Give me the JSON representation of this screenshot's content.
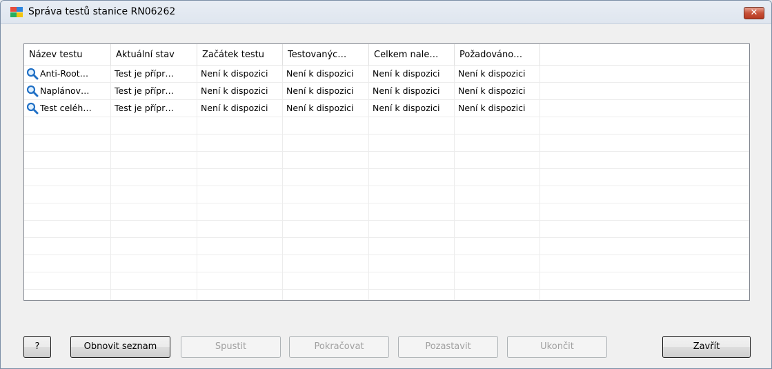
{
  "window": {
    "title": "Správa testů stanice RN06262",
    "close_label": "✕"
  },
  "grid": {
    "columns": [
      "Název testu",
      "Aktuální stav",
      "Začátek testu",
      "Testovanýc…",
      "Celkem nale…",
      "Požadováno…"
    ],
    "rows": [
      [
        "Anti-Root…",
        "Test je přípr…",
        "Není k dispozici",
        "Není k dispozici",
        "Není k dispozici",
        "Není k dispozici"
      ],
      [
        "Naplánov…",
        "Test je přípr…",
        "Není k dispozici",
        "Není k dispozici",
        "Není k dispozici",
        "Není k dispozici"
      ],
      [
        "Test celéh…",
        "Test je přípr…",
        "Není k dispozici",
        "Není k dispozici",
        "Není k dispozici",
        "Není k dispozici"
      ]
    ],
    "row_icon": "magnifier-icon"
  },
  "buttons": {
    "help": "?",
    "refresh": "Obnovit seznam",
    "start": "Spustit",
    "resume": "Pokračovat",
    "pause": "Pozastavit",
    "stop": "Ukončit",
    "close": "Zavřít"
  },
  "colors": {
    "accent_blue": "#1f6fc5",
    "disabled_text": "#a0a0a0"
  }
}
